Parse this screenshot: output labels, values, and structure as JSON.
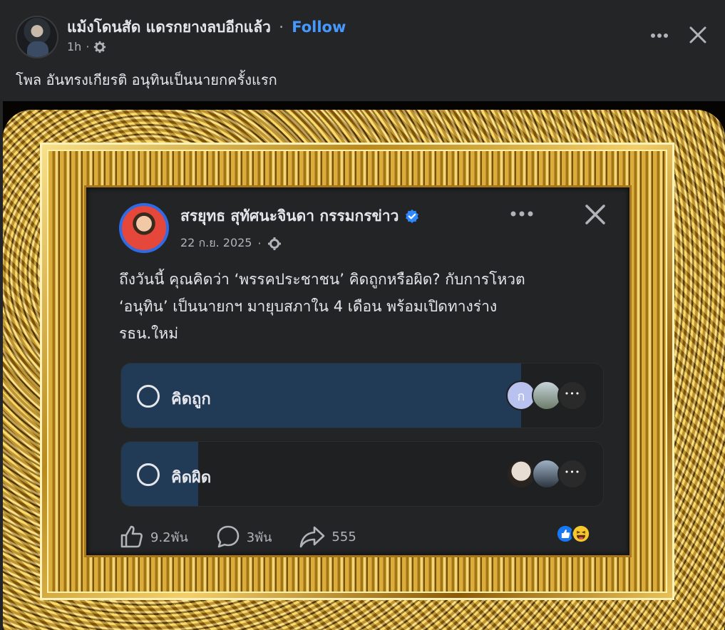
{
  "post": {
    "author": "แม้งโดนสัด แดรกยางลบอีกแล้ว",
    "separator": "·",
    "follow_label": "Follow",
    "time": "1h",
    "time_dot": "·",
    "caption": "โพล อันทรงเกียรติ อนุทินเป็นนายกครั้งแรก",
    "more_icon": "more-horizontal-icon",
    "close_icon": "close-icon",
    "privacy_icon": "gear-icon"
  },
  "embedded": {
    "author": "สรยุทธ สุทัศนะจินดา กรรมกรข่าว",
    "verified_icon": "verified-badge-icon",
    "date": "22 ก.ย. 2025",
    "date_dot": "·",
    "text_line1": "ถึงวันนี้ คุณคิดว่า ‘พรรคประชาชน’ คิดถูกหรือผิด? กับการโหวต",
    "text_line2": "‘อนุทิน’ เป็นนายกฯ มายุบสภาใน 4 เดือน พร้อมเปิดทางร่าง",
    "text_line3": "รธน.ใหม่",
    "poll": [
      {
        "label": "คิดถูก",
        "share": 0.83,
        "voter_initial": "ก",
        "voter_colors": [
          "#b9c2ee",
          "#8a9aa0",
          "#2a2a2a"
        ]
      },
      {
        "label": "คิดผิด",
        "share": 0.16,
        "voter_colors": [
          "#d8d0c8",
          "#6a7d92",
          "#2a2a2a"
        ]
      }
    ],
    "likes": "9.2พัน",
    "comments": "3พัน",
    "shares": "555",
    "reaction_icons": [
      "like-reaction-icon",
      "haha-reaction-icon"
    ],
    "colors": {
      "poll_fill": "#213a56",
      "verified": "#2e89ff",
      "follow": "#4599ff"
    }
  }
}
